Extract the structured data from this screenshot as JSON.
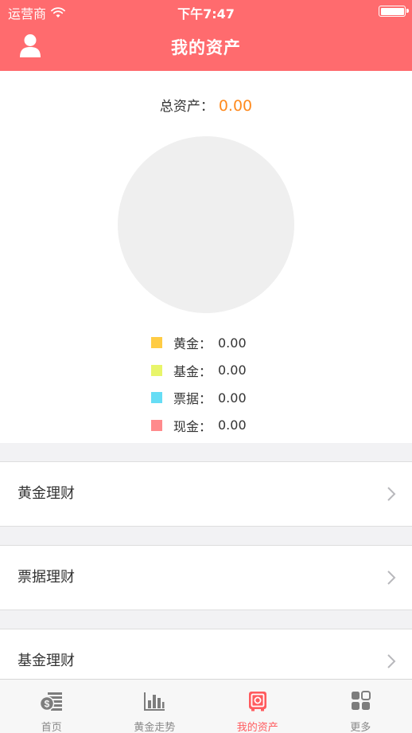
{
  "status_bar": {
    "carrier": "运营商",
    "time": "下午7:47"
  },
  "header": {
    "title": "我的资产"
  },
  "summary": {
    "total_label": "总资产：",
    "total_value": "0.00",
    "legend": [
      {
        "label": "黄金：",
        "value": "0.00",
        "color": "#ffcc44"
      },
      {
        "label": "基金：",
        "value": "0.00",
        "color": "#e8f56a"
      },
      {
        "label": "票据：",
        "value": "0.00",
        "color": "#66ddf5"
      },
      {
        "label": "现金：",
        "value": "0.00",
        "color": "#ff8a8c"
      }
    ]
  },
  "rows": [
    {
      "label": "黄金理财"
    },
    {
      "label": "票据理财"
    },
    {
      "label": "基金理财"
    }
  ],
  "tabbar": {
    "items": [
      {
        "label": "首页",
        "icon": "coins-icon"
      },
      {
        "label": "黄金走势",
        "icon": "bar-chart-icon"
      },
      {
        "label": "我的资产",
        "icon": "safe-icon"
      },
      {
        "label": "更多",
        "icon": "grid-icon"
      }
    ],
    "active_index": 2
  },
  "colors": {
    "accent": "#ff6b6e",
    "total_value": "#ff8a1e",
    "pie_empty": "#efefef"
  }
}
